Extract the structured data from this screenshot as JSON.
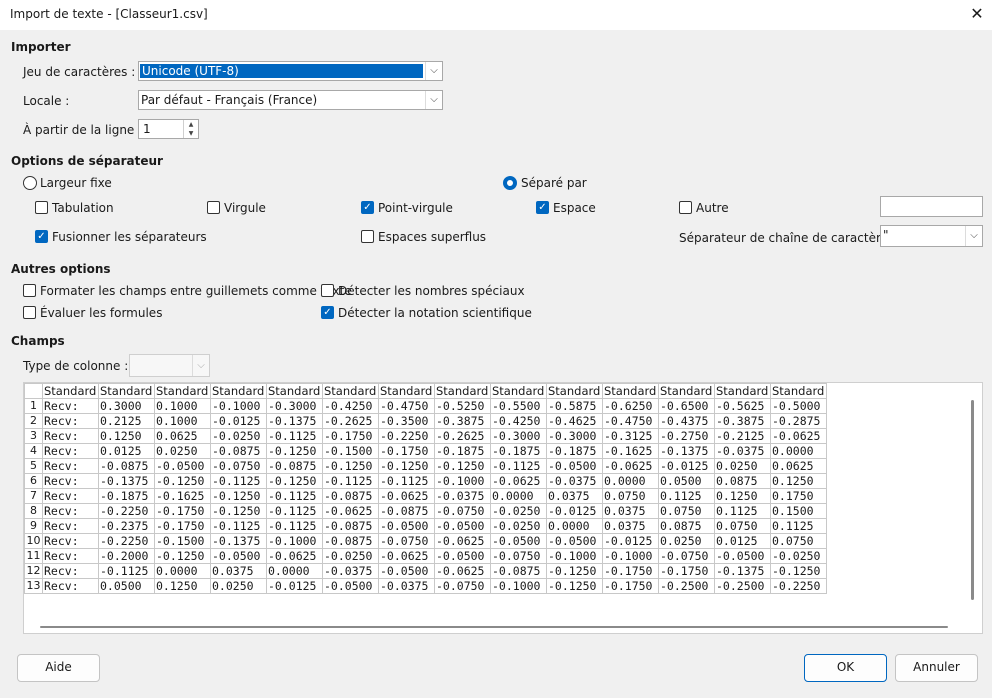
{
  "window": {
    "title": "Import de texte - [Classeur1.csv]",
    "close_glyph": "✕"
  },
  "import": {
    "section": "Importer",
    "charset_label": "Jeu de caractères :",
    "charset_value": "Unicode (UTF-8)",
    "locale_label": "Locale :",
    "locale_value": "Par défaut - Français (France)",
    "from_line_label": "À partir de la ligne :",
    "from_line_value": "1"
  },
  "separator": {
    "section": "Options de séparateur",
    "fixed_width": "Largeur fixe",
    "separated_by": "Séparé par",
    "tab": "Tabulation",
    "comma": "Virgule",
    "semicolon": "Point-virgule",
    "space": "Espace",
    "other": "Autre",
    "other_value": "",
    "merge": "Fusionner les séparateurs",
    "trim_spaces": "Espaces superflus",
    "string_delim_label": "Séparateur de chaîne de caractères :",
    "string_delim_value": "\""
  },
  "other_options": {
    "section": "Autres options",
    "quoted_as_text": "Formater les champs entre guillemets comme texte",
    "detect_special": "Détecter les nombres spéciaux",
    "eval_formulas": "Évaluer les formules",
    "detect_scientific": "Détecter la notation scientifique"
  },
  "fields": {
    "section": "Champs",
    "column_type_label": "Type de colonne :",
    "column_type_value": "",
    "headers": [
      "Standard",
      "Standard",
      "Standard",
      "Standard",
      "Standard",
      "Standard",
      "Standard",
      "Standard",
      "Standard",
      "Standard",
      "Standard",
      "Standard",
      "Standard",
      "Standard"
    ],
    "rows": [
      [
        "1",
        "Recv:",
        "0.3000",
        "0.1000",
        "-0.1000",
        "-0.3000",
        "-0.4250",
        "-0.4750",
        "-0.5250",
        "-0.5500",
        "-0.5875",
        "-0.6250",
        "-0.6500",
        "-0.5625",
        "-0.5000"
      ],
      [
        "2",
        "Recv:",
        "0.2125",
        "0.1000",
        "-0.0125",
        "-0.1375",
        "-0.2625",
        "-0.3500",
        "-0.3875",
        "-0.4250",
        "-0.4625",
        "-0.4750",
        "-0.4375",
        "-0.3875",
        "-0.2875"
      ],
      [
        "3",
        "Recv:",
        "0.1250",
        "0.0625",
        "-0.0250",
        "-0.1125",
        "-0.1750",
        "-0.2250",
        "-0.2625",
        "-0.3000",
        "-0.3000",
        "-0.3125",
        "-0.2750",
        "-0.2125",
        "-0.0625"
      ],
      [
        "4",
        "Recv:",
        "0.0125",
        "0.0250",
        "-0.0875",
        "-0.1250",
        "-0.1500",
        "-0.1750",
        "-0.1875",
        "-0.1875",
        "-0.1875",
        "-0.1625",
        "-0.1375",
        "-0.0375",
        "0.0000"
      ],
      [
        "5",
        "Recv:",
        "-0.0875",
        "-0.0500",
        "-0.0750",
        "-0.0875",
        "-0.1250",
        "-0.1250",
        "-0.1250",
        "-0.1125",
        "-0.0500",
        "-0.0625",
        "-0.0125",
        "0.0250",
        "0.0625"
      ],
      [
        "6",
        "Recv:",
        "-0.1375",
        "-0.1250",
        "-0.1125",
        "-0.1250",
        "-0.1125",
        "-0.1125",
        "-0.1000",
        "-0.0625",
        "-0.0375",
        "0.0000",
        "0.0500",
        "0.0875",
        "0.1250"
      ],
      [
        "7",
        "Recv:",
        "-0.1875",
        "-0.1625",
        "-0.1250",
        "-0.1125",
        "-0.0875",
        "-0.0625",
        "-0.0375",
        "0.0000",
        "0.0375",
        "0.0750",
        "0.1125",
        "0.1250",
        "0.1750"
      ],
      [
        "8",
        "Recv:",
        "-0.2250",
        "-0.1750",
        "-0.1250",
        "-0.1125",
        "-0.0625",
        "-0.0875",
        "-0.0750",
        "-0.0250",
        "-0.0125",
        "0.0375",
        "0.0750",
        "0.1125",
        "0.1500"
      ],
      [
        "9",
        "Recv:",
        "-0.2375",
        "-0.1750",
        "-0.1125",
        "-0.1125",
        "-0.0875",
        "-0.0500",
        "-0.0500",
        "-0.0250",
        "0.0000",
        "0.0375",
        "0.0875",
        "0.0750",
        "0.1125"
      ],
      [
        "10",
        "Recv:",
        "-0.2250",
        "-0.1500",
        "-0.1375",
        "-0.1000",
        "-0.0875",
        "-0.0750",
        "-0.0625",
        "-0.0500",
        "-0.0500",
        "-0.0125",
        "0.0250",
        "0.0125",
        "0.0750"
      ],
      [
        "11",
        "Recv:",
        "-0.2000",
        "-0.1250",
        "-0.0500",
        "-0.0625",
        "-0.0250",
        "-0.0625",
        "-0.0500",
        "-0.0750",
        "-0.1000",
        "-0.1000",
        "-0.0750",
        "-0.0500",
        "-0.0250"
      ],
      [
        "12",
        "Recv:",
        "-0.1125",
        "0.0000",
        "0.0375",
        "0.0000",
        "-0.0375",
        "-0.0500",
        "-0.0625",
        "-0.0875",
        "-0.1250",
        "-0.1750",
        "-0.1750",
        "-0.1375",
        "-0.1250"
      ],
      [
        "13",
        "Recv:",
        "0.0500",
        "0.1250",
        "0.0250",
        "-0.0125",
        "-0.0500",
        "-0.0375",
        "-0.0750",
        "-0.1000",
        "-0.1250",
        "-0.1750",
        "-0.2500",
        "-0.2500",
        "-0.2250"
      ]
    ]
  },
  "buttons": {
    "help": "Aide",
    "ok": "OK",
    "cancel": "Annuler"
  },
  "colors": {
    "accent": "#0067c0"
  }
}
